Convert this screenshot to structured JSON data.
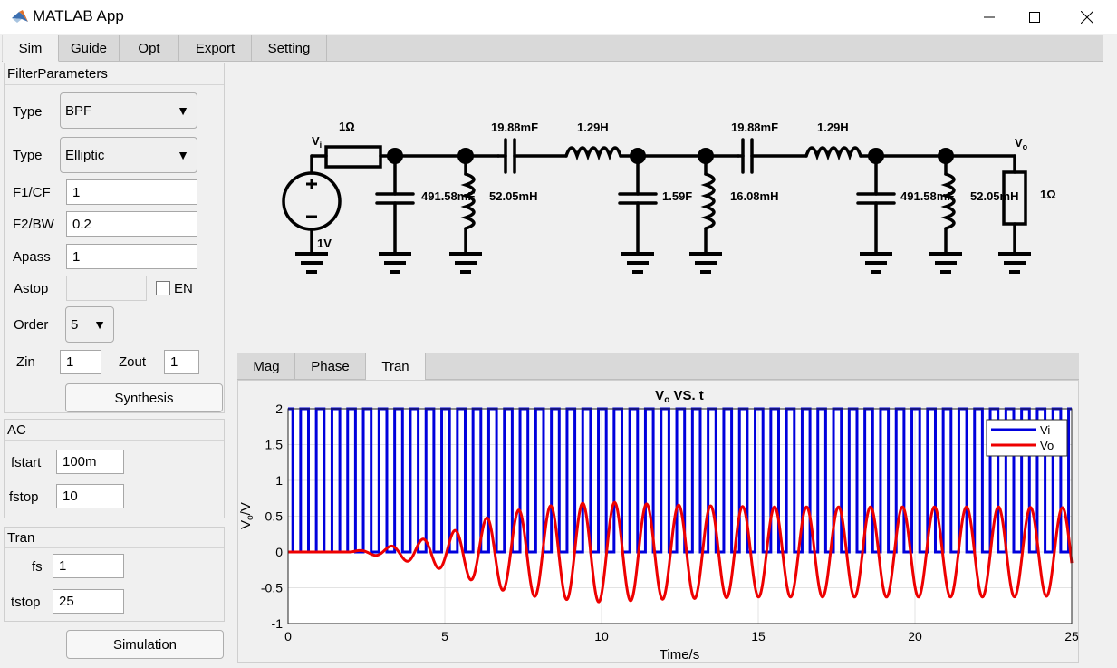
{
  "window": {
    "title": "MATLAB App",
    "icon": "matlab-logo-icon",
    "controls": [
      "minimize-icon",
      "maximize-icon",
      "close-icon"
    ]
  },
  "main_tabs": [
    {
      "label": "Sim",
      "active": true
    },
    {
      "label": "Guide",
      "active": false
    },
    {
      "label": "Opt",
      "active": false
    },
    {
      "label": "Export",
      "active": false
    },
    {
      "label": "Setting",
      "active": false
    }
  ],
  "filter_params": {
    "title": "FilterParameters",
    "type1": {
      "label": "Type",
      "value": "BPF"
    },
    "type2": {
      "label": "Type",
      "value": "Elliptic"
    },
    "f1": {
      "label": "F1/CF",
      "value": "1"
    },
    "f2": {
      "label": "F2/BW",
      "value": "0.2"
    },
    "apass": {
      "label": "Apass",
      "value": "1"
    },
    "astop": {
      "label": "Astop",
      "value": "",
      "enable_label": "EN",
      "enabled": false
    },
    "order": {
      "label": "Order",
      "value": "5"
    },
    "zin": {
      "label": "Zin",
      "value": "1"
    },
    "zout": {
      "label": "Zout",
      "value": "1"
    },
    "synthesis_label": "Synthesis"
  },
  "ac": {
    "title": "AC",
    "fstart": {
      "label": "fstart",
      "value": "100m"
    },
    "fstop": {
      "label": "fstop",
      "value": "10"
    }
  },
  "tran": {
    "title": "Tran",
    "fs": {
      "label": "fs",
      "value": "1"
    },
    "tstop": {
      "label": "tstop",
      "value": "25"
    },
    "simulation_label": "Simulation"
  },
  "schematic": {
    "vi_label": "V",
    "vi_sub": "i",
    "vo_label": "V",
    "vo_sub": "o",
    "source_value": "1V",
    "rin": "1Ω",
    "c_series1": "19.88mF",
    "l_series1": "1.29H",
    "c_series2": "19.88mF",
    "l_series2": "1.29H",
    "c_shunt1": "491.58mF",
    "l_shunt1": "52.05mH",
    "c_shunt2": "1.59F",
    "l_shunt2": "16.08mH",
    "c_shunt3": "491.58mF",
    "l_shunt3": "52.05mH",
    "rout": "1Ω"
  },
  "plot_tabs": [
    {
      "label": "Mag",
      "active": false
    },
    {
      "label": "Phase",
      "active": false
    },
    {
      "label": "Tran",
      "active": true
    }
  ],
  "chart_data": {
    "type": "line",
    "title_main": "V",
    "title_sub": "o",
    "title_rest": " VS. t",
    "xlabel": "Time/s",
    "ylabel_main": "V",
    "ylabel_sub": "o",
    "ylabel_rest": "/V",
    "xlim": [
      0,
      25
    ],
    "ylim": [
      -1,
      2
    ],
    "xticks": [
      "0",
      "5",
      "10",
      "15",
      "20",
      "25"
    ],
    "yticks": [
      "-1",
      "-0.5",
      "0",
      "0.5",
      "1",
      "1.5",
      "2"
    ],
    "grid": true,
    "legend_position": "top-right",
    "series": [
      {
        "name": "Vi",
        "color": "#0000dd",
        "kind": "square",
        "period": 0.5,
        "duty": 0.5,
        "high": 2,
        "low": 0,
        "first_rise": 0.4
      },
      {
        "name": "Vo",
        "color": "#ee0000",
        "kind": "bandpass-response",
        "x": [
          0,
          1,
          2,
          2.5,
          3,
          3.5,
          4,
          4.5,
          5,
          5.5,
          6,
          6.5,
          7,
          7.5,
          8,
          9,
          10,
          11,
          12,
          13,
          14,
          15,
          16,
          17,
          18,
          19,
          20,
          21,
          22,
          23,
          24,
          25
        ],
        "envelope": [
          0,
          0,
          0.01,
          0.03,
          0.06,
          0.1,
          0.15,
          0.2,
          0.25,
          0.33,
          0.42,
          0.5,
          0.55,
          0.6,
          0.63,
          0.67,
          0.7,
          0.68,
          0.66,
          0.65,
          0.64,
          0.63,
          0.63,
          0.63,
          0.63,
          0.63,
          0.63,
          0.63,
          0.63,
          0.63,
          0.62,
          0.62
        ],
        "frequency": 0.98,
        "onset": 2.0
      }
    ]
  }
}
